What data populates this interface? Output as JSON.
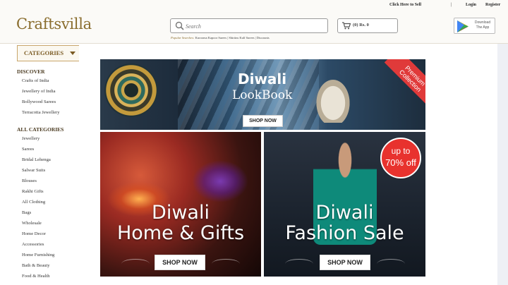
{
  "header": {
    "logo": "Craftsvilla",
    "click_here_to_sell": "Click Here to Sell",
    "separator": "|",
    "login": "Login",
    "register": "Register",
    "search": {
      "placeholder": "Search",
      "icon": "search-icon"
    },
    "popular_searches": {
      "label": "Popular Searches:",
      "items": "Kurooma Kapoor Sarees | Shirtins Kulf Sarees | Discounts"
    },
    "cart": {
      "label": "(0) Rs. 0",
      "icon": "cart-icon"
    },
    "app": {
      "line1": "Download",
      "line2": "The App",
      "icon": "play-store-icon"
    }
  },
  "sidebar": {
    "categories_button": "CATEGORIES",
    "discover": {
      "title": "DISCOVER",
      "items": [
        "Crafts of India",
        "Jewellery of India",
        "Bollywood Sarees",
        "Terracotta Jewellery"
      ]
    },
    "all_categories": {
      "title": "ALL CATEGORIES",
      "items": [
        "Jewellery",
        "Sarees",
        "Bridal Lehenga",
        "Salwar Suits",
        "Blouses",
        "Rakhi Gifts",
        "All Clothing",
        "Bags",
        "Wholesale",
        "Home Decor",
        "Accessories",
        "Home Furnishing",
        "Bath & Beauty",
        "Food & Health"
      ]
    }
  },
  "banners": {
    "lookbook": {
      "title1": "Diwali",
      "title2": "LookBook",
      "ribbon": "Premium Collection",
      "cta": "SHOP NOW"
    },
    "home_gifts": {
      "line1": "Diwali",
      "line2": "Home & Gifts",
      "cta": "SHOP NOW"
    },
    "fashion_sale": {
      "line1": "Diwali",
      "line2": "Fashion Sale",
      "badge1": "up to",
      "badge2": "70% off",
      "cta": "SHOP NOW"
    }
  },
  "colors": {
    "brand": "#8a6d2e",
    "badge_red": "#e8322e",
    "accent_gold": "#c9a66b"
  }
}
